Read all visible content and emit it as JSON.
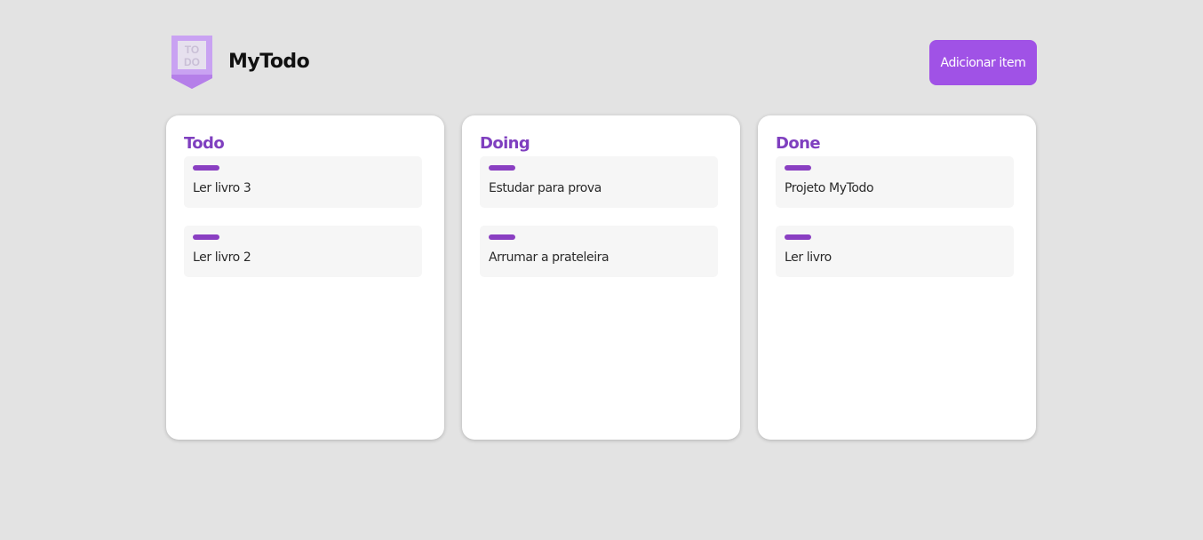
{
  "header": {
    "logo_text_top": "TO",
    "logo_text_bottom": "DO",
    "title": "MyTodo",
    "add_button_label": "Adicionar item"
  },
  "colors": {
    "background": "#e3e3e3",
    "accent": "#a052e6",
    "column_title": "#7f3fbf",
    "card_tag": "#8a3fc2",
    "card_background": "#f6f6f6"
  },
  "columns": [
    {
      "title": "Todo",
      "cards": [
        {
          "text": "Ler livro 3"
        },
        {
          "text": "Ler livro 2"
        }
      ]
    },
    {
      "title": "Doing",
      "cards": [
        {
          "text": "Estudar para prova"
        },
        {
          "text": "Arrumar a prateleira"
        }
      ]
    },
    {
      "title": "Done",
      "cards": [
        {
          "text": "Projeto MyTodo"
        },
        {
          "text": "Ler livro"
        }
      ]
    }
  ]
}
